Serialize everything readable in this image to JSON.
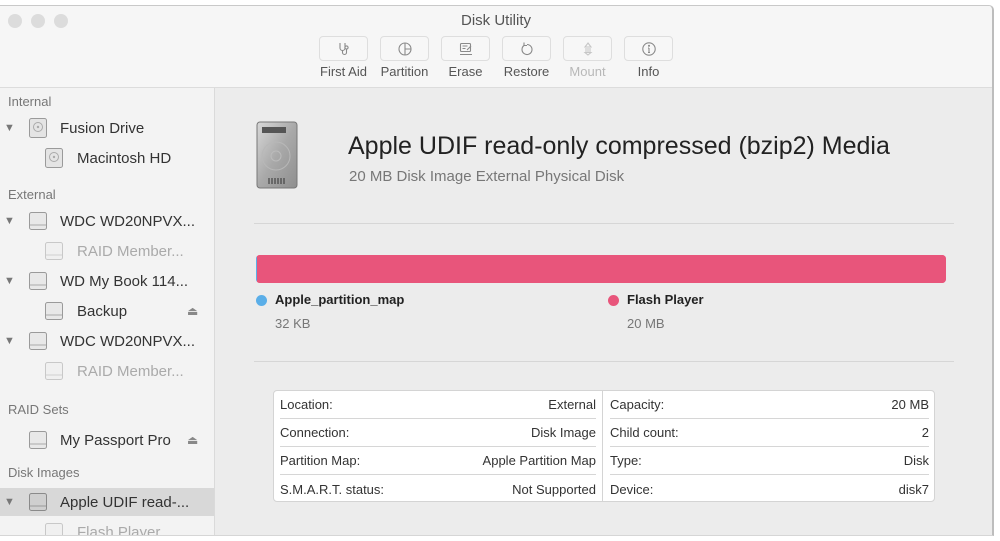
{
  "window": {
    "title": "Disk Utility"
  },
  "toolbar": {
    "items": [
      {
        "label": "First Aid",
        "icon": "stethoscope-icon",
        "enabled": true
      },
      {
        "label": "Partition",
        "icon": "partition-pie-icon",
        "enabled": true
      },
      {
        "label": "Erase",
        "icon": "erase-icon",
        "enabled": true
      },
      {
        "label": "Restore",
        "icon": "restore-arrow-icon",
        "enabled": true
      },
      {
        "label": "Mount",
        "icon": "mount-icon",
        "enabled": false
      },
      {
        "label": "Info",
        "icon": "info-icon",
        "enabled": true
      }
    ]
  },
  "sidebar": {
    "sections": {
      "internal": "Internal",
      "external": "External",
      "raid_sets": "RAID Sets",
      "disk_images": "Disk Images"
    },
    "items": [
      {
        "label": "Fusion Drive",
        "level": 0,
        "expanded": true,
        "dim": false,
        "eject": false,
        "icon": "internal-disk-icon"
      },
      {
        "label": "Macintosh HD",
        "level": 1,
        "dim": false,
        "eject": false,
        "icon": "internal-volume-icon"
      },
      {
        "label": "WDC WD20NPVX...",
        "level": 0,
        "expanded": true,
        "dim": false,
        "eject": false,
        "icon": "external-disk-icon"
      },
      {
        "label": "RAID Member...",
        "level": 1,
        "dim": true,
        "eject": false,
        "icon": "external-volume-icon"
      },
      {
        "label": "WD My Book 114...",
        "level": 0,
        "expanded": true,
        "dim": false,
        "eject": false,
        "icon": "external-disk-icon"
      },
      {
        "label": "Backup",
        "level": 1,
        "dim": false,
        "eject": true,
        "icon": "external-volume-icon"
      },
      {
        "label": "WDC WD20NPVX...",
        "level": 0,
        "expanded": true,
        "dim": false,
        "eject": false,
        "icon": "external-disk-icon"
      },
      {
        "label": "RAID Member...",
        "level": 1,
        "dim": true,
        "eject": false,
        "icon": "external-volume-icon"
      },
      {
        "label": "My Passport Pro",
        "level": 1,
        "dim": false,
        "eject": true,
        "icon": "raid-set-icon"
      },
      {
        "label": "Apple UDIF read-...",
        "level": 0,
        "expanded": true,
        "dim": false,
        "eject": false,
        "selected": true,
        "icon": "disk-image-icon"
      },
      {
        "label": "Flash Player",
        "level": 1,
        "dim": true,
        "eject": false,
        "icon": "disk-image-volume-icon"
      }
    ],
    "eject_glyph": "⏏",
    "triangle_glyph": "▼"
  },
  "main": {
    "title": "Apple UDIF read-only compressed (bzip2) Media",
    "subtitle": "20 MB Disk Image External Physical Disk",
    "partitions": [
      {
        "name": "Apple_partition_map",
        "size": "32 KB",
        "color": "#5aaee8",
        "fraction": 0.0016
      },
      {
        "name": "Flash Player",
        "size": "20 MB",
        "color": "#e8557b",
        "fraction": 0.9984
      }
    ],
    "info_left": [
      {
        "label": "Location:",
        "value": "External"
      },
      {
        "label": "Connection:",
        "value": "Disk Image"
      },
      {
        "label": "Partition Map:",
        "value": "Apple Partition Map"
      },
      {
        "label": "S.M.A.R.T. status:",
        "value": "Not Supported"
      }
    ],
    "info_right": [
      {
        "label": "Capacity:",
        "value": "20 MB"
      },
      {
        "label": "Child count:",
        "value": "2"
      },
      {
        "label": "Type:",
        "value": "Disk"
      },
      {
        "label": "Device:",
        "value": "disk7"
      }
    ]
  }
}
